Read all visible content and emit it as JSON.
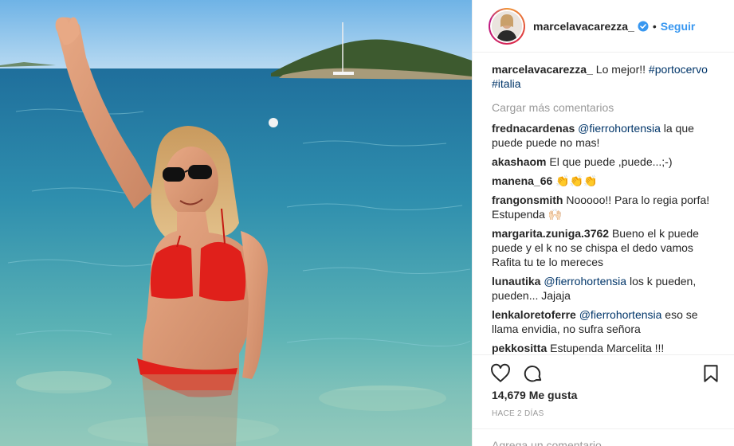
{
  "post": {
    "username": "marcelavacarezza_",
    "follow_label": "Seguir",
    "separator": "•",
    "caption": {
      "user": "marcelavacarezza_",
      "text": " Lo mejor!! ",
      "tag1": "#portocervo",
      "tag2": "#italia"
    },
    "load_more": "Cargar más comentarios",
    "comments": [
      {
        "user": "frednacardenas",
        "mention": "@fierrohortensia",
        "text": " la que puede puede no mas!"
      },
      {
        "user": "akashaom",
        "mention": "",
        "text": " El que puede ,puede...;-)"
      },
      {
        "user": "manena_66",
        "mention": "",
        "text": " 👏👏👏"
      },
      {
        "user": "frangonsmith",
        "mention": "",
        "text": " Nooooo!! Para lo regia porfa! Estupenda 🙌🏻"
      },
      {
        "user": "margarita.zuniga.3762",
        "mention": "",
        "text": " Bueno el k puede puede y el k no se chispa el dedo vamos Rafita tu te lo mereces"
      },
      {
        "user": "lunautika",
        "mention": "@fierrohortensia",
        "text": " los k pueden, pueden... Jajaja"
      },
      {
        "user": "lenkaloretoferre",
        "mention": "@fierrohortensia",
        "text": " eso se llama envidia, no sufra señora"
      },
      {
        "user": "pekkositta",
        "mention": "",
        "text": " Estupenda Marcelita !!!"
      }
    ],
    "likes": "14,679 Me gusta",
    "time": "HACE 2 DÍAS",
    "comment_placeholder": "Agrega un comentario..."
  },
  "icons": {
    "like": "heart-icon",
    "comment": "comment-icon",
    "save": "bookmark-icon",
    "verified": "verified-badge-icon"
  },
  "colors": {
    "link": "#3897f0",
    "mention": "#003569",
    "muted": "#999999",
    "text": "#262626",
    "verified": "#3897f0"
  }
}
